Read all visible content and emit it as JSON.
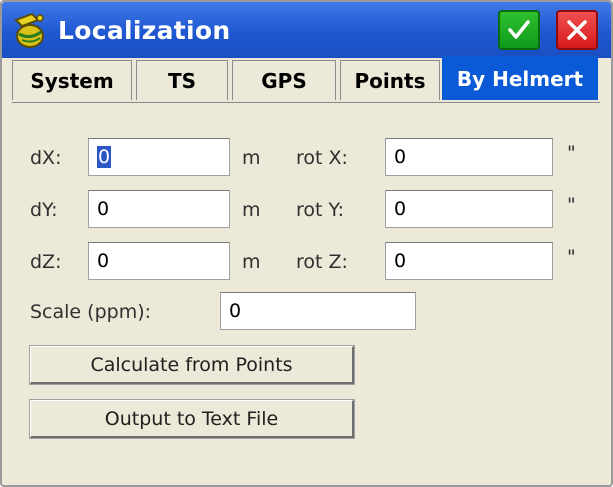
{
  "window": {
    "title": "Localization"
  },
  "tabs": [
    {
      "label": "System"
    },
    {
      "label": "TS"
    },
    {
      "label": "GPS"
    },
    {
      "label": "Points"
    },
    {
      "label": "By Helmert",
      "active": true
    }
  ],
  "form": {
    "rows": [
      {
        "label": "dX:",
        "value": "0",
        "unit": "m",
        "rot_label": "rot X:",
        "rot_value": "0",
        "rot_unit": "\""
      },
      {
        "label": "dY:",
        "value": "0",
        "unit": "m",
        "rot_label": "rot Y:",
        "rot_value": "0",
        "rot_unit": "\""
      },
      {
        "label": "dZ:",
        "value": "0",
        "unit": "m",
        "rot_label": "rot Z:",
        "rot_value": "0",
        "rot_unit": "\""
      }
    ],
    "scale_label": "Scale (ppm):",
    "scale_value": "0"
  },
  "buttons": {
    "calculate": "Calculate from Points",
    "output": "Output to Text File"
  },
  "colors": {
    "titlebar": "#1f57d0",
    "active_tab": "#0a5ad8",
    "ok": "#1aa826",
    "close": "#e02222",
    "panel": "#ece9d8"
  }
}
